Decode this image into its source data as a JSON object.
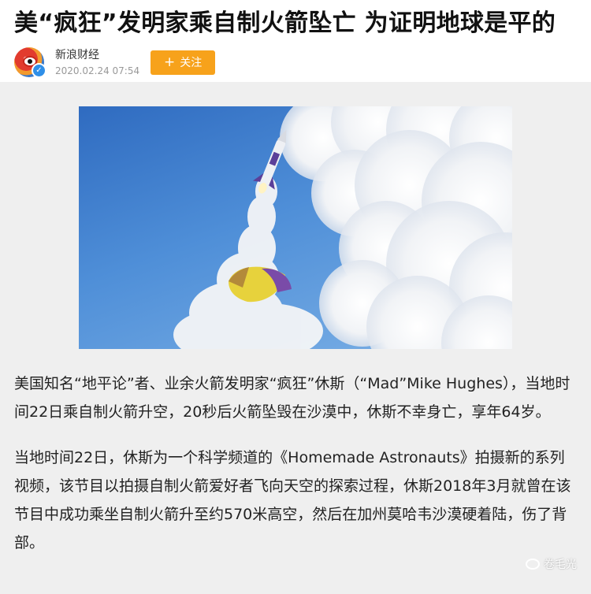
{
  "article": {
    "title": "美“疯狂”发明家乘自制火箭坠亡 为证明地球是平的",
    "author": "新浪财经",
    "date": "2020.02.24  07:54",
    "follow_label": "关注",
    "paragraphs": [
      "美国知名“地平论”者、业余火箭发明家“疯狂”休斯（“Mad”Mike Hughes），当地时间22日乘自制火箭升空，20秒后火箭坠毁在沙漠中，休斯不幸身亡，享年64岁。",
      "当地时间22日，休斯为一个科学频道的《Homemade Astronauts》拍摄新的系列视频，该节目以拍摄自制火箭爱好者飞向天空的探索过程，休斯2018年3月就曾在该节目中成功乘坐自制火箭升至约570米高空，然后在加州莫哈韦沙漠硬着陆，伤了背部。"
    ]
  },
  "watermark": "卷毛光",
  "icons": {
    "avatar": "sina-eye-logo",
    "verified": "verified-check-icon",
    "follow": "plus-icon",
    "watermark": "wechat-icon"
  },
  "colors": {
    "follow_button": "#f7a21b",
    "verified_badge": "#2f8fe8",
    "content_bg": "#efefef",
    "sky": "#4f8fd8"
  }
}
